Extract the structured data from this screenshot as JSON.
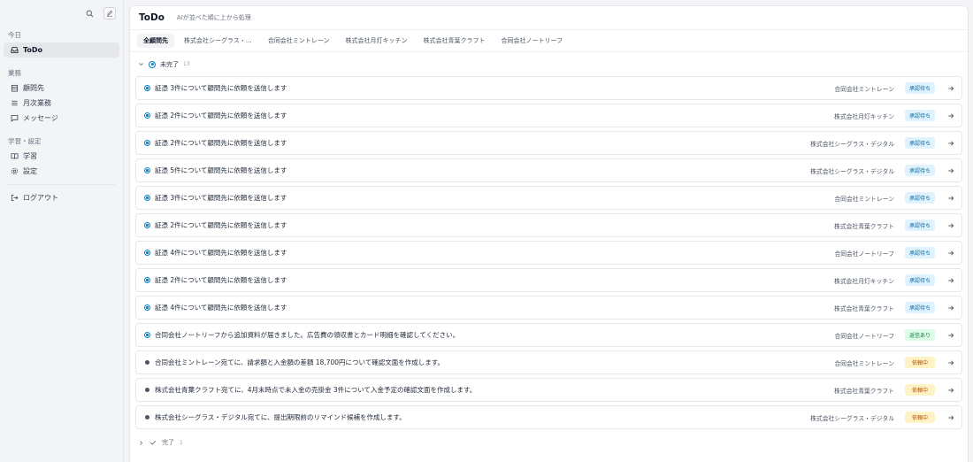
{
  "sidebar": {
    "sections": [
      {
        "label": "今日",
        "items": [
          {
            "label": "ToDo",
            "icon": "inbox-icon",
            "active": true
          }
        ]
      },
      {
        "label": "業務",
        "items": [
          {
            "label": "顧問先",
            "icon": "building-icon"
          },
          {
            "label": "月次業務",
            "icon": "list-icon"
          },
          {
            "label": "メッセージ",
            "icon": "message-icon"
          }
        ]
      },
      {
        "label": "学習・設定",
        "items": [
          {
            "label": "学習",
            "icon": "book-icon"
          },
          {
            "label": "設定",
            "icon": "gear-icon"
          }
        ]
      }
    ],
    "logout": "ログアウト"
  },
  "header": {
    "title": "ToDo",
    "subtitle": "AIが並べた順に上から処理"
  },
  "tabs": [
    "全顧問先",
    "株式会社シーグラス・…",
    "合同会社ミントレーン",
    "株式会社月灯キッチン",
    "株式会社青葉クラフト",
    "合同会社ノートリーフ"
  ],
  "group": {
    "label": "未完了",
    "count": "13"
  },
  "rows": [
    {
      "text": "証憑 3件について顧問先に依頼を送信します",
      "client": "合同会社ミントレーン",
      "status": "承認待ち",
      "kind": "approval",
      "dot": "blue"
    },
    {
      "text": "証憑 2件について顧問先に依頼を送信します",
      "client": "株式会社月灯キッチン",
      "status": "承認待ち",
      "kind": "approval",
      "dot": "blue"
    },
    {
      "text": "証憑 2件について顧問先に依頼を送信します",
      "client": "株式会社シーグラス・デジタル",
      "status": "承認待ち",
      "kind": "approval",
      "dot": "blue"
    },
    {
      "text": "証憑 5件について顧問先に依頼を送信します",
      "client": "株式会社シーグラス・デジタル",
      "status": "承認待ち",
      "kind": "approval",
      "dot": "blue"
    },
    {
      "text": "証憑 3件について顧問先に依頼を送信します",
      "client": "合同会社ミントレーン",
      "status": "承認待ち",
      "kind": "approval",
      "dot": "blue"
    },
    {
      "text": "証憑 2件について顧問先に依頼を送信します",
      "client": "株式会社青葉クラフト",
      "status": "承認待ち",
      "kind": "approval",
      "dot": "blue"
    },
    {
      "text": "証憑 4件について顧問先に依頼を送信します",
      "client": "合同会社ノートリーフ",
      "status": "承認待ち",
      "kind": "approval",
      "dot": "blue"
    },
    {
      "text": "証憑 2件について顧問先に依頼を送信します",
      "client": "株式会社月灯キッチン",
      "status": "承認待ち",
      "kind": "approval",
      "dot": "blue"
    },
    {
      "text": "証憑 4件について顧問先に依頼を送信します",
      "client": "株式会社青葉クラフト",
      "status": "承認待ち",
      "kind": "approval",
      "dot": "blue"
    },
    {
      "text": "合同会社ノートリーフから追加資料が届きました。広告費の領収書とカード明細を確認してください。",
      "client": "合同会社ノートリーフ",
      "status": "返信あり",
      "kind": "reply",
      "dot": "blue"
    },
    {
      "text": "合同会社ミントレーン宛てに、請求額と入金額の差額 18,700円について確認文面を作成します。",
      "client": "合同会社ミントレーン",
      "status": "依頼中",
      "kind": "request",
      "dot": "gray"
    },
    {
      "text": "株式会社青葉クラフト宛てに、4月末時点で未入金の売掛金 3件について入金予定の確認文面を作成します。",
      "client": "株式会社青葉クラフト",
      "status": "依頼中",
      "kind": "request",
      "dot": "gray"
    },
    {
      "text": "株式会社シーグラス・デジタル宛てに、提出期限前のリマインド候補を作成します。",
      "client": "株式会社シーグラス・デジタル",
      "status": "依頼中",
      "kind": "request",
      "dot": "gray"
    }
  ],
  "done": {
    "label": "完了",
    "count": "1"
  },
  "colors": {
    "accent": "#0284c7",
    "approval_bg": "#e0f2fe",
    "reply_bg": "#dcfce7",
    "request_bg": "#fef3c7"
  }
}
